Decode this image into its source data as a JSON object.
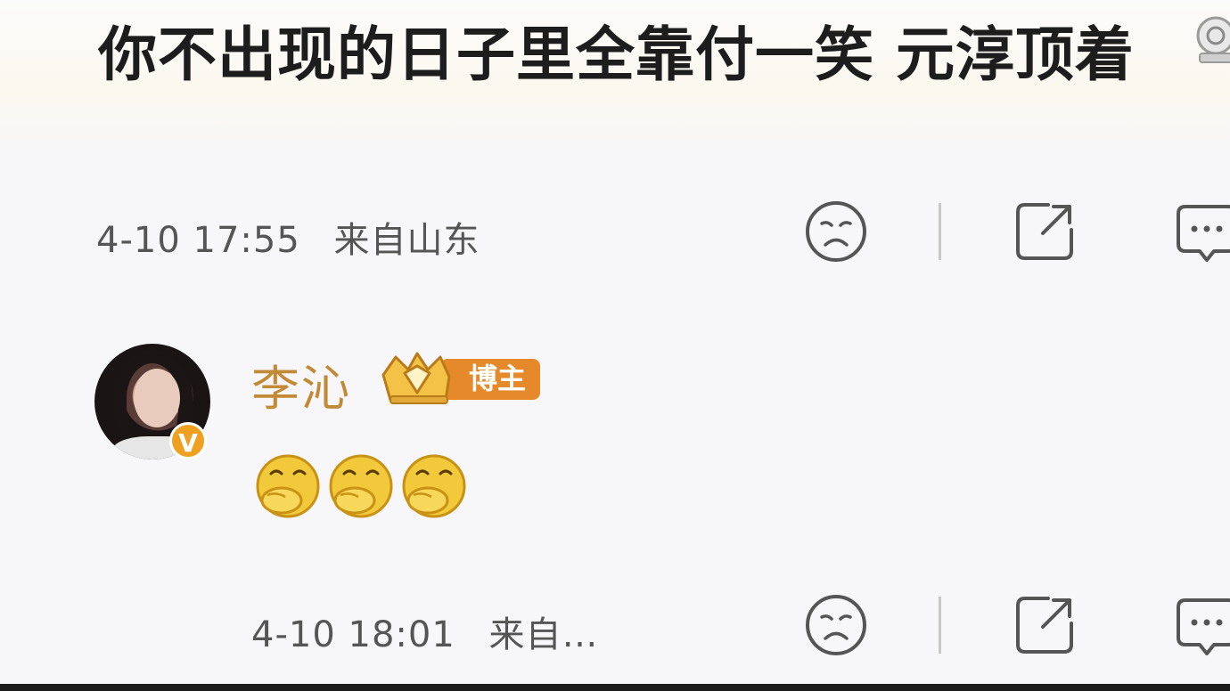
{
  "post": {
    "text": "你不出现的日子里全靠付一笑 元淳顶着",
    "timestamp": "4-10 17:55",
    "location": "来自山东"
  },
  "comment": {
    "username": "李沁",
    "badge_label": "博主",
    "verified_mark": "V",
    "emojis": [
      "laugh-cover-mouth-emoji",
      "laugh-cover-mouth-emoji",
      "laugh-cover-mouth-emoji"
    ],
    "timestamp": "4-10 18:01",
    "location": "来自…"
  },
  "icons": {
    "reaction": "sad-face-icon",
    "share": "share-icon",
    "comment": "comment-icon",
    "medal": "medal-icon"
  },
  "colors": {
    "username": "#c28a36",
    "badge_orange": "#e5892a",
    "verified_orange": "#f0a020",
    "icon_gray": "#555555"
  }
}
